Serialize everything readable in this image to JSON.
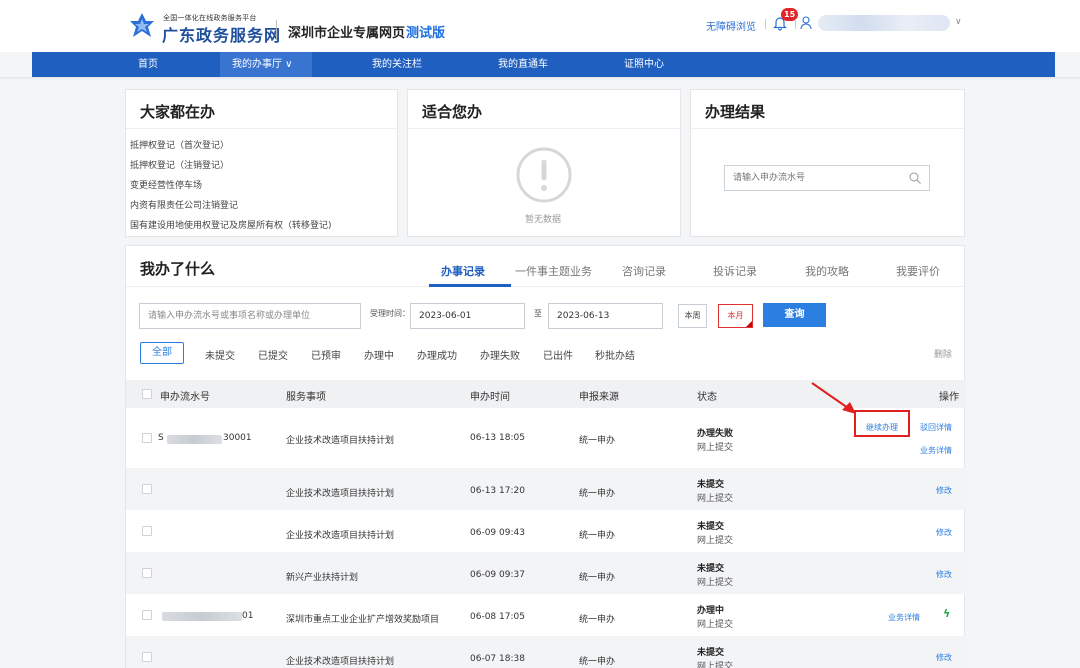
{
  "header": {
    "platform_small": "全国一体化在线政务服务平台",
    "platform_name": "广东政务服务网",
    "site_title": "深圳市企业专属网页",
    "site_tag": "测试版",
    "accessibility": "无障碍浏览",
    "notification_count": "15",
    "user_caret": "∨"
  },
  "nav": {
    "items": [
      "首页",
      "我的办事厅 ∨",
      "我的关注栏",
      "我的直通车",
      "证照中心"
    ]
  },
  "popular": {
    "title": "大家都在办",
    "items": [
      "抵押权登记（首次登记）",
      "抵押权登记（注销登记）",
      "变更经营性停车场",
      "内资有限责任公司注销登记",
      "国有建设用地使用权登记及房屋所有权（转移登记)"
    ]
  },
  "suitable": {
    "title": "适合您办",
    "empty_text": "暂无数据"
  },
  "result": {
    "title": "办理结果",
    "placeholder": "请输入申办流水号"
  },
  "records": {
    "title": "我办了什么",
    "tabs": [
      "办事记录",
      "一件事主题业务",
      "咨询记录",
      "投诉记录",
      "我的攻略",
      "我要评价"
    ],
    "search_placeholder": "请输入申办流水号或事项名称或办理单位",
    "time_label": "受理时间：",
    "date_from": "2023-06-01",
    "to_label": "至",
    "date_to": "2023-06-13",
    "btn_week": "本周",
    "btn_month": "本月",
    "btn_query": "查询",
    "filters": [
      "全部",
      "未提交",
      "已提交",
      "已预审",
      "办理中",
      "办理成功",
      "办理失败",
      "已出件",
      "秒批办结"
    ],
    "delete": "删除",
    "columns": [
      "申办流水号",
      "服务事项",
      "申办时间",
      "申报来源",
      "状态",
      "操作"
    ],
    "rows": [
      {
        "id_prefix": "S",
        "id_suffix": "30001",
        "service": "企业技术改造项目扶持计划",
        "time": "06-13 18:05",
        "source": "统一申办",
        "status": "办理失败",
        "channel": "网上提交",
        "ops": [
          "继续办理",
          "驳回详情",
          "业务详情"
        ]
      },
      {
        "id_prefix": "",
        "id_suffix": "",
        "service": "企业技术改造项目扶持计划",
        "time": "06-13 17:20",
        "source": "统一申办",
        "status": "未提交",
        "channel": "网上提交",
        "ops": [
          "修改"
        ]
      },
      {
        "id_prefix": "",
        "id_suffix": "",
        "service": "企业技术改造项目扶持计划",
        "time": "06-09 09:43",
        "source": "统一申办",
        "status": "未提交",
        "channel": "网上提交",
        "ops": [
          "修改"
        ]
      },
      {
        "id_prefix": "",
        "id_suffix": "",
        "service": "新兴产业扶持计划",
        "time": "06-09 09:37",
        "source": "统一申办",
        "status": "未提交",
        "channel": "网上提交",
        "ops": [
          "修改"
        ]
      },
      {
        "id_prefix": "",
        "id_suffix": "01",
        "service": "深圳市重点工业企业扩产增效奖励项目",
        "time": "06-08 17:05",
        "source": "统一申办",
        "status": "办理中",
        "channel": "网上提交",
        "ops": [
          "业务详情"
        ]
      },
      {
        "id_prefix": "",
        "id_suffix": "",
        "service": "企业技术改造项目扶持计划",
        "time": "06-07 18:38",
        "source": "统一申办",
        "status": "未提交",
        "channel": "网上提交",
        "ops": [
          "修改"
        ]
      }
    ]
  },
  "colors": {
    "brand_blue": "#1f5fc0",
    "link_blue": "#2b7fe0",
    "highlight_red": "#e12020"
  }
}
